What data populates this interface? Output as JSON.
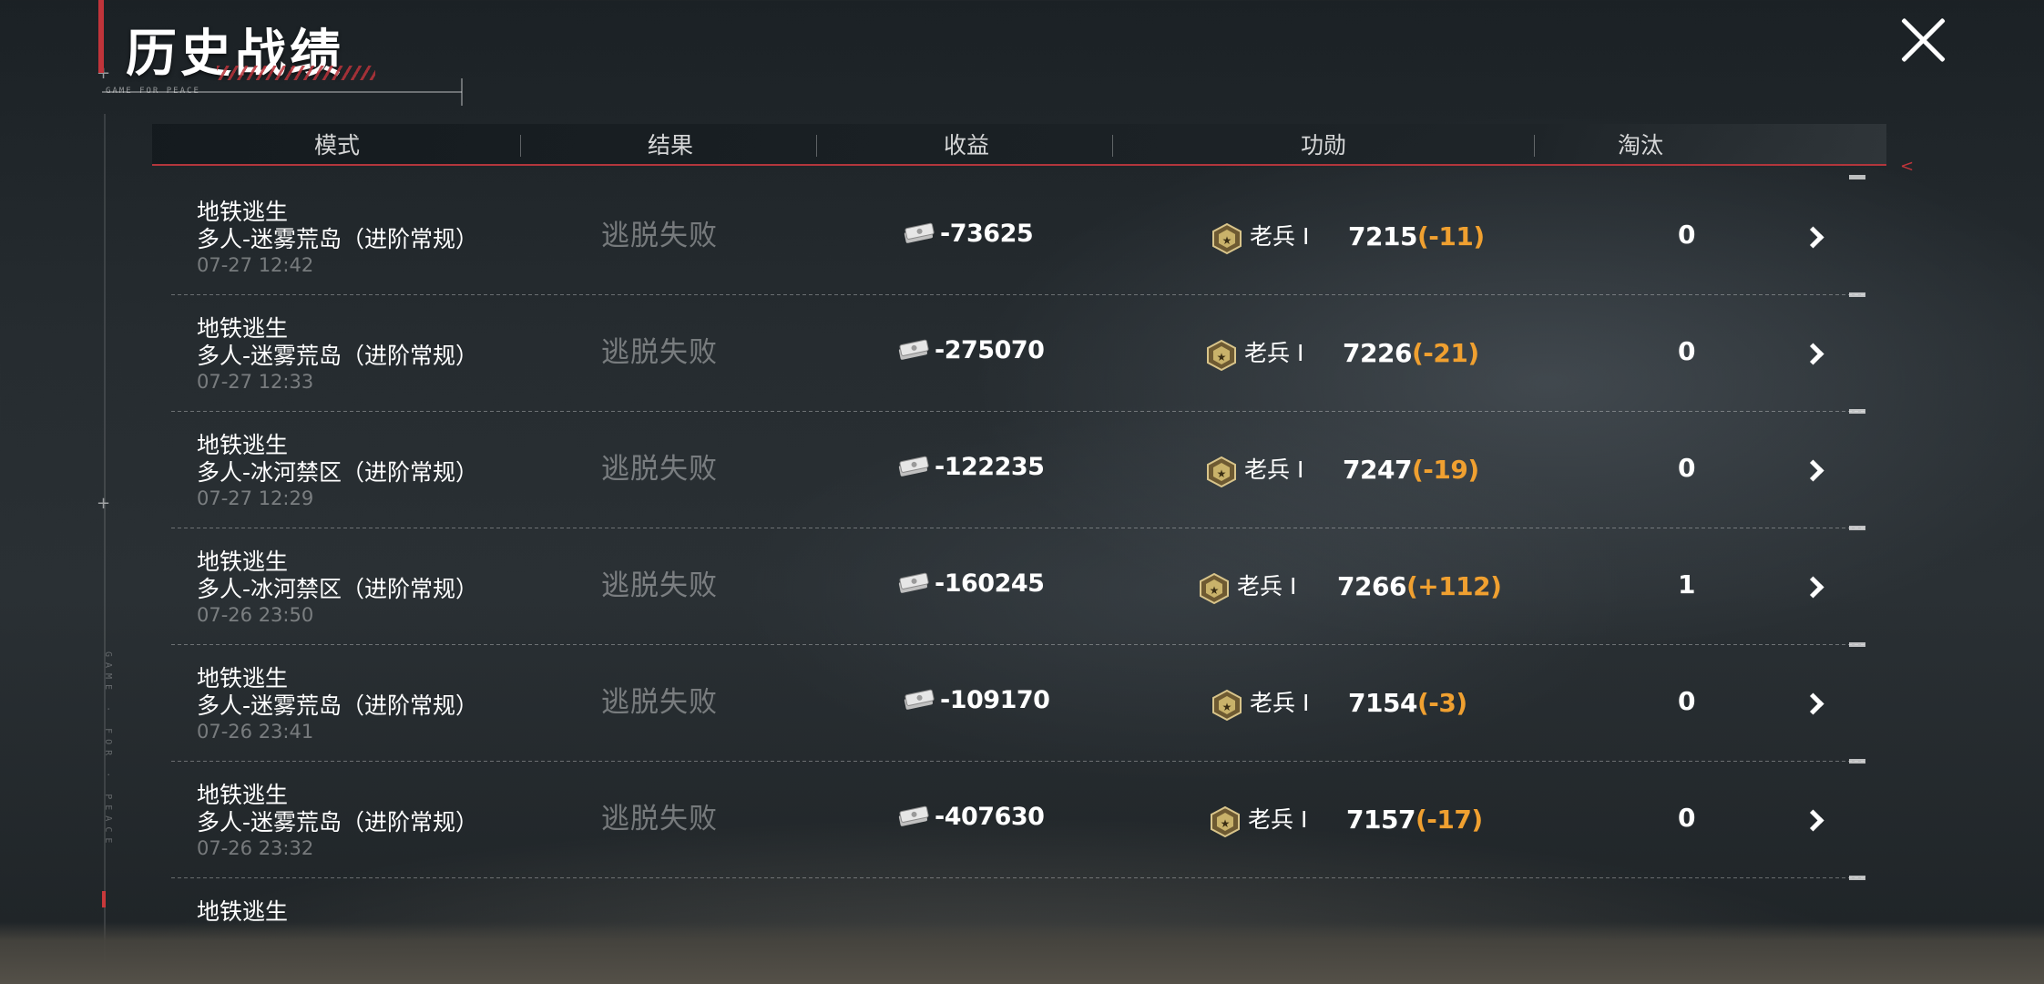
{
  "header": {
    "title": "历史战绩",
    "tagline": "GAME FOR PEACE",
    "close_icon": "close-icon"
  },
  "side": {
    "vertical_text": "GAME · FOR · PEACE"
  },
  "table": {
    "columns": [
      "模式",
      "结果",
      "收益",
      "功勋",
      "淘汰"
    ],
    "rows": [
      {
        "mode": "地铁逃生",
        "map": "多人-迷雾荒岛（进阶常规）",
        "time": "07-27 12:42",
        "result": "逃脱失败",
        "income": "-73625",
        "rank": "老兵 I",
        "merit": "7215",
        "merit_delta": "(-11)",
        "eliminations": "0"
      },
      {
        "mode": "地铁逃生",
        "map": "多人-迷雾荒岛（进阶常规）",
        "time": "07-27 12:33",
        "result": "逃脱失败",
        "income": "-275070",
        "rank": "老兵 I",
        "merit": "7226",
        "merit_delta": "(-21)",
        "eliminations": "0"
      },
      {
        "mode": "地铁逃生",
        "map": "多人-冰河禁区（进阶常规）",
        "time": "07-27 12:29",
        "result": "逃脱失败",
        "income": "-122235",
        "rank": "老兵 I",
        "merit": "7247",
        "merit_delta": "(-19)",
        "eliminations": "0"
      },
      {
        "mode": "地铁逃生",
        "map": "多人-冰河禁区（进阶常规）",
        "time": "07-26 23:50",
        "result": "逃脱失败",
        "income": "-160245",
        "rank": "老兵 I",
        "merit": "7266",
        "merit_delta": "(+112)",
        "eliminations": "1"
      },
      {
        "mode": "地铁逃生",
        "map": "多人-迷雾荒岛（进阶常规）",
        "time": "07-26 23:41",
        "result": "逃脱失败",
        "income": "-109170",
        "rank": "老兵 I",
        "merit": "7154",
        "merit_delta": "(-3)",
        "eliminations": "0"
      },
      {
        "mode": "地铁逃生",
        "map": "多人-迷雾荒岛（进阶常规）",
        "time": "07-26 23:32",
        "result": "逃脱失败",
        "income": "-407630",
        "rank": "老兵 I",
        "merit": "7157",
        "merit_delta": "(-17)",
        "eliminations": "0"
      },
      {
        "mode": "地铁逃生"
      }
    ]
  },
  "icons": {
    "income": "cash-stack-icon",
    "rank": "veteran-rank-badge-icon",
    "detail": "chevron-right-icon"
  },
  "colors": {
    "accent_red": "#c0343a",
    "merit_delta": "#f0a030",
    "muted_text": "rgba(255,255,255,0.38)"
  }
}
